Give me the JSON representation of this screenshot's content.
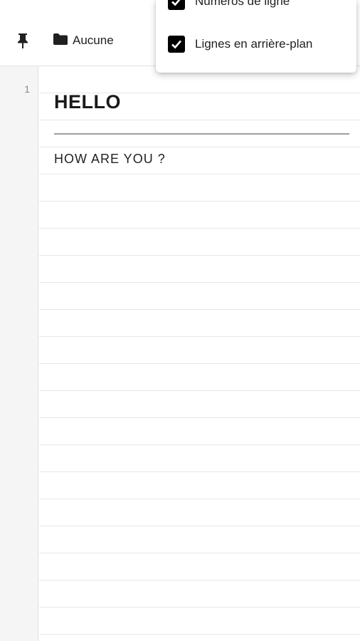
{
  "toolbar": {
    "pin_icon": "pin-icon",
    "folder_icon": "folder-icon",
    "folder_label": "Aucune"
  },
  "menu": {
    "items": [
      {
        "label": "Numéros de ligne",
        "checked": true
      },
      {
        "label": "Lignes en arrière-plan",
        "checked": true
      }
    ]
  },
  "editor": {
    "line_numbers": [
      "1"
    ],
    "heading": "HELLO",
    "paragraph": "HOW ARE YOU ?"
  },
  "colors": {
    "gutter_bg": "#f5f5f5",
    "ruled_line": "#e6e6e6",
    "checkbox": "#000000",
    "divider": "#9e9e9e"
  }
}
